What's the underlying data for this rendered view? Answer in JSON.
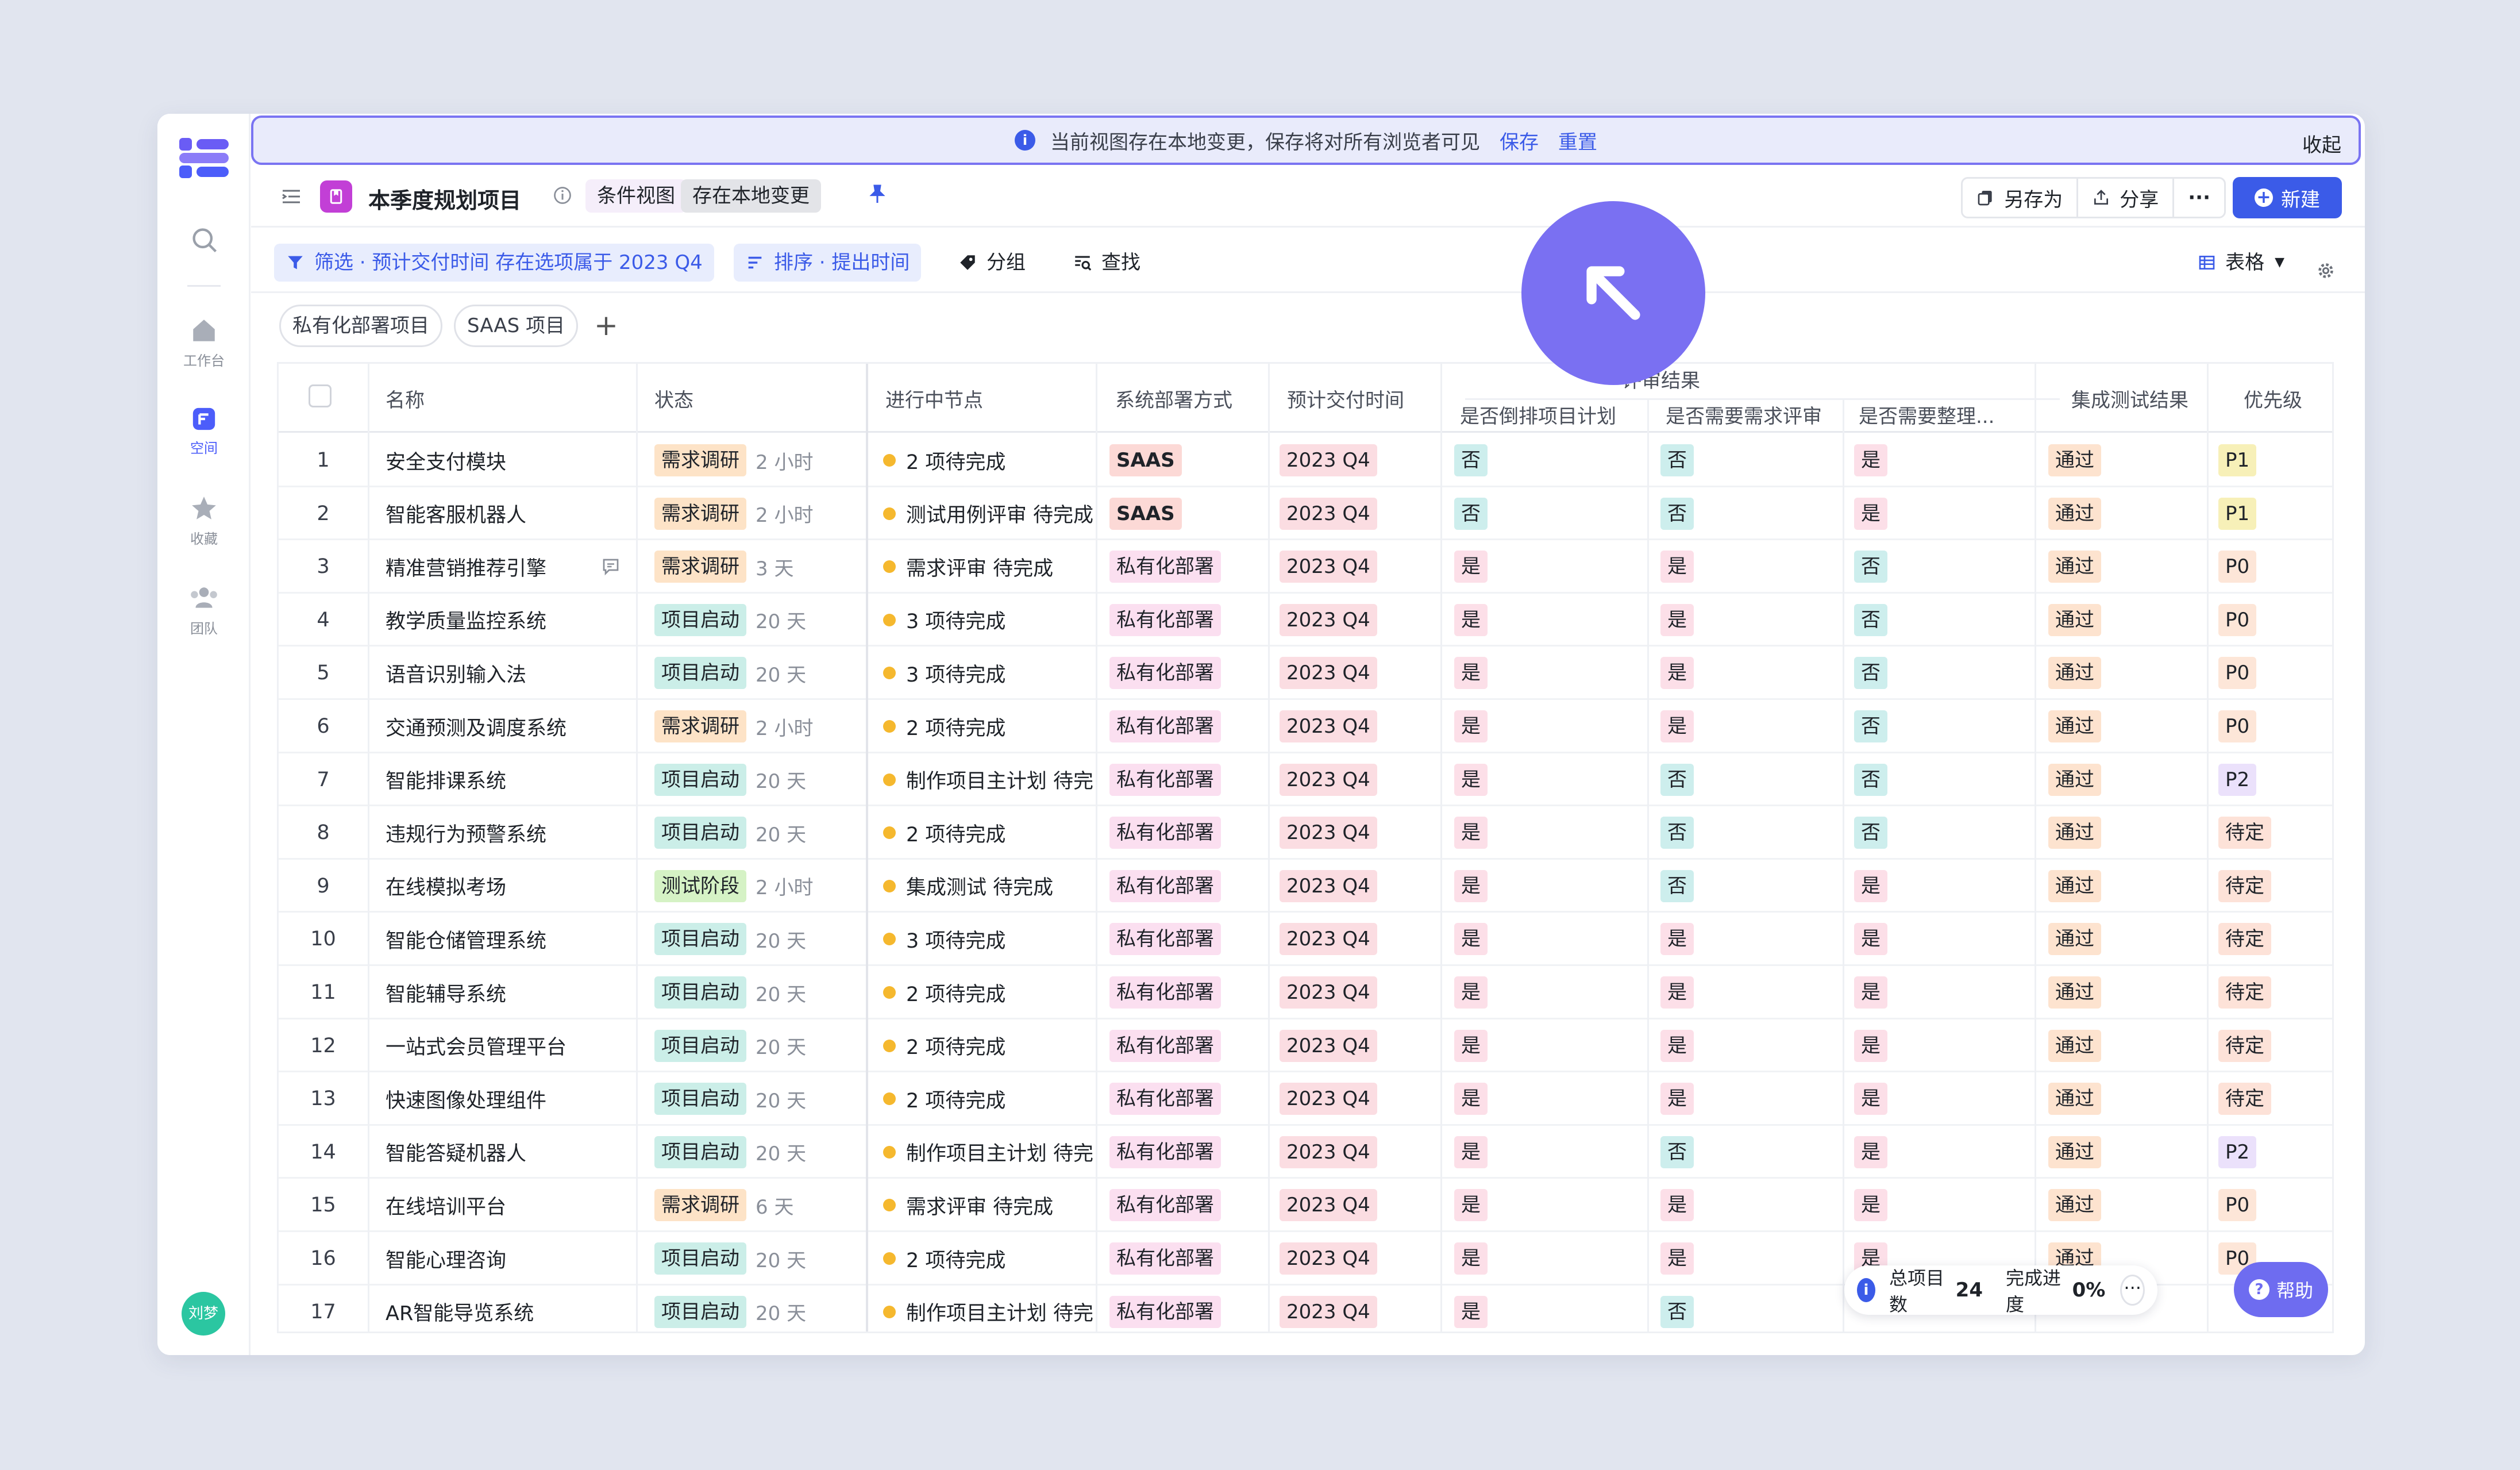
{
  "colors": {
    "accent": "#3b5be8",
    "banner_border": "#7a74f2",
    "brand_purple": "#c23fd6"
  },
  "sidebar": {
    "items": [
      {
        "label": "工作台",
        "icon": "home-icon"
      },
      {
        "label": "空间",
        "icon": "space-icon",
        "active": true
      },
      {
        "label": "收藏",
        "icon": "star-icon"
      },
      {
        "label": "团队",
        "icon": "team-icon"
      }
    ],
    "avatar": "刘梦"
  },
  "banner": {
    "message": "当前视图存在本地变更，保存将对所有浏览者可见",
    "save": "保存",
    "reset": "重置",
    "collapse": "收起"
  },
  "header": {
    "title": "本季度规划项目",
    "tag_condition": "条件视图",
    "tag_local": "存在本地变更",
    "save_as": "另存为",
    "share": "分享",
    "more": "···",
    "new": "新建"
  },
  "toolbar": {
    "filter": "筛选 · 预计交付时间 存在选项属于 2023 Q4",
    "sort": "排序 · 提出时间",
    "group": "分组",
    "find": "查找",
    "view": "表格"
  },
  "quick_filters": [
    "私有化部署项目",
    "SAAS 项目"
  ],
  "table": {
    "group_header": "评审结果",
    "columns": {
      "name": "名称",
      "status": "状态",
      "node": "进行中节点",
      "deploy": "系统部署方式",
      "delivery": "预计交付时间",
      "r1": "是否倒排项目计划",
      "r2": "是否需要需求评审",
      "r3": "是否需要整理...",
      "test": "集成测试结果",
      "priority": "优先级"
    },
    "rows": [
      {
        "n": "1",
        "name": "安全支付模块",
        "status": "需求调研",
        "ago": "2 小时",
        "node": "2 项待完成",
        "deploy": "SAAS",
        "delivery": "2023 Q4",
        "r1": "否",
        "r2": "否",
        "r3": "是",
        "test": "通过",
        "priority": "P1"
      },
      {
        "n": "2",
        "name": "智能客服机器人",
        "status": "需求调研",
        "ago": "2 小时",
        "node": "测试用例评审 待完成",
        "deploy": "SAAS",
        "delivery": "2023 Q4",
        "r1": "否",
        "r2": "否",
        "r3": "是",
        "test": "通过",
        "priority": "P1"
      },
      {
        "n": "3",
        "name": "精准营销推荐引擎",
        "status": "需求调研",
        "ago": "3 天",
        "node": "需求评审 待完成",
        "deploy": "私有化部署",
        "delivery": "2023 Q4",
        "r1": "是",
        "r2": "是",
        "r3": "否",
        "test": "通过",
        "priority": "P0",
        "comment": true
      },
      {
        "n": "4",
        "name": "教学质量监控系统",
        "status": "项目启动",
        "ago": "20 天",
        "node": "3 项待完成",
        "deploy": "私有化部署",
        "delivery": "2023 Q4",
        "r1": "是",
        "r2": "是",
        "r3": "否",
        "test": "通过",
        "priority": "P0"
      },
      {
        "n": "5",
        "name": "语音识别输入法",
        "status": "项目启动",
        "ago": "20 天",
        "node": "3 项待完成",
        "deploy": "私有化部署",
        "delivery": "2023 Q4",
        "r1": "是",
        "r2": "是",
        "r3": "否",
        "test": "通过",
        "priority": "P0"
      },
      {
        "n": "6",
        "name": "交通预测及调度系统",
        "status": "需求调研",
        "ago": "2 小时",
        "node": "2 项待完成",
        "deploy": "私有化部署",
        "delivery": "2023 Q4",
        "r1": "是",
        "r2": "是",
        "r3": "否",
        "test": "通过",
        "priority": "P0"
      },
      {
        "n": "7",
        "name": "智能排课系统",
        "status": "项目启动",
        "ago": "20 天",
        "node": "制作项目主计划 待完",
        "deploy": "私有化部署",
        "delivery": "2023 Q4",
        "r1": "是",
        "r2": "否",
        "r3": "否",
        "test": "通过",
        "priority": "P2"
      },
      {
        "n": "8",
        "name": "违规行为预警系统",
        "status": "项目启动",
        "ago": "20 天",
        "node": "2 项待完成",
        "deploy": "私有化部署",
        "delivery": "2023 Q4",
        "r1": "是",
        "r2": "否",
        "r3": "否",
        "test": "通过",
        "priority": "待定"
      },
      {
        "n": "9",
        "name": "在线模拟考场",
        "status": "测试阶段",
        "ago": "2 小时",
        "node": "集成测试 待完成",
        "deploy": "私有化部署",
        "delivery": "2023 Q4",
        "r1": "是",
        "r2": "否",
        "r3": "是",
        "test": "通过",
        "priority": "待定"
      },
      {
        "n": "10",
        "name": "智能仓储管理系统",
        "status": "项目启动",
        "ago": "20 天",
        "node": "3 项待完成",
        "deploy": "私有化部署",
        "delivery": "2023 Q4",
        "r1": "是",
        "r2": "是",
        "r3": "是",
        "test": "通过",
        "priority": "待定"
      },
      {
        "n": "11",
        "name": "智能辅导系统",
        "status": "项目启动",
        "ago": "20 天",
        "node": "2 项待完成",
        "deploy": "私有化部署",
        "delivery": "2023 Q4",
        "r1": "是",
        "r2": "是",
        "r3": "是",
        "test": "通过",
        "priority": "待定"
      },
      {
        "n": "12",
        "name": "一站式会员管理平台",
        "status": "项目启动",
        "ago": "20 天",
        "node": "2 项待完成",
        "deploy": "私有化部署",
        "delivery": "2023 Q4",
        "r1": "是",
        "r2": "是",
        "r3": "是",
        "test": "通过",
        "priority": "待定"
      },
      {
        "n": "13",
        "name": "快速图像处理组件",
        "status": "项目启动",
        "ago": "20 天",
        "node": "2 项待完成",
        "deploy": "私有化部署",
        "delivery": "2023 Q4",
        "r1": "是",
        "r2": "是",
        "r3": "是",
        "test": "通过",
        "priority": "待定"
      },
      {
        "n": "14",
        "name": "智能答疑机器人",
        "status": "项目启动",
        "ago": "20 天",
        "node": "制作项目主计划 待完",
        "deploy": "私有化部署",
        "delivery": "2023 Q4",
        "r1": "是",
        "r2": "否",
        "r3": "是",
        "test": "通过",
        "priority": "P2"
      },
      {
        "n": "15",
        "name": "在线培训平台",
        "status": "需求调研",
        "ago": "6 天",
        "node": "需求评审 待完成",
        "deploy": "私有化部署",
        "delivery": "2023 Q4",
        "r1": "是",
        "r2": "是",
        "r3": "是",
        "test": "通过",
        "priority": "P0"
      },
      {
        "n": "16",
        "name": "智能心理咨询",
        "status": "项目启动",
        "ago": "20 天",
        "node": "2 项待完成",
        "deploy": "私有化部署",
        "delivery": "2023 Q4",
        "r1": "是",
        "r2": "是",
        "r3": "是",
        "test": "通过",
        "priority": "P0"
      },
      {
        "n": "17",
        "name": "AR智能导览系统",
        "status": "项目启动",
        "ago": "20 天",
        "node": "制作项目主计划 待完",
        "deploy": "私有化部署",
        "delivery": "2023 Q4",
        "r1": "是",
        "r2": "否",
        "r3": "",
        "test": "",
        "priority": ""
      }
    ]
  },
  "footer": {
    "total_label": "总项目数",
    "total": "24",
    "progress_label": "完成进度",
    "progress": "0%",
    "more": "···",
    "help": "帮助"
  }
}
